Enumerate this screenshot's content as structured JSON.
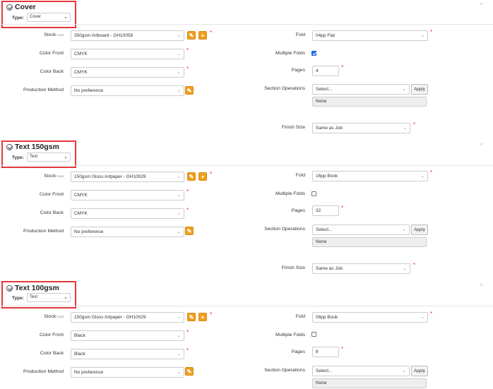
{
  "labels": {
    "type": "Type:",
    "stock": "Stock",
    "stock_sub": "Cust",
    "color_front": "Color Front",
    "color_back": "Color Back",
    "production_method": "Production Method",
    "fold": "Fold",
    "multiple_folds": "Multiple Folds",
    "pages": "Pages",
    "section_operations": "Section Operations",
    "finish_size": "Finish Size",
    "apply": "Apply",
    "required": "*",
    "close": "×",
    "edit_btn": "✎",
    "add_btn": "+",
    "chevron": "⌄"
  },
  "sections": [
    {
      "title": "Cover",
      "type": "Cover",
      "stock": "350gsm Artboard - GH10058",
      "color_front": "CMYK",
      "color_back": "CMYK",
      "production_method": "No preference",
      "fold": "04pp Flat",
      "multiple_folds": true,
      "pages": "4",
      "section_operations": "Select...",
      "operations_value": "None",
      "finish_size": "Same as Job"
    },
    {
      "title": "Text 150gsm",
      "type": "Text",
      "stock": "150gsm Gloss Artpaper - GH10029",
      "color_front": "CMYK",
      "color_back": "CMYK",
      "production_method": "No preference",
      "fold": "16pp Book",
      "multiple_folds": false,
      "pages": "32",
      "section_operations": "Select...",
      "operations_value": "None",
      "finish_size": "Same as Job"
    },
    {
      "title": "Text 100gsm",
      "type": "Text",
      "stock": "150gsm Gloss Artpaper - GH10029",
      "color_front": "Black",
      "color_back": "Black",
      "production_method": "No preference",
      "fold": "08pp Book",
      "multiple_folds": false,
      "pages": "8",
      "section_operations": "Select...",
      "operations_value": "None"
    }
  ]
}
